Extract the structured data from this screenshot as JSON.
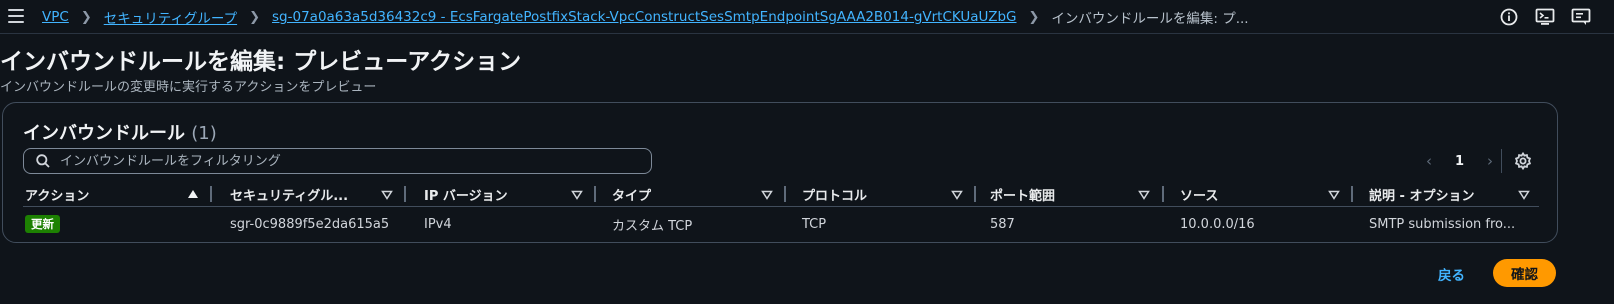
{
  "topbar": {
    "breadcrumbs": [
      "VPC",
      "セキュリティグループ",
      "sg-07a0a63a5d36432c9 - EcsFargatePostfixStack-VpcConstructSesSmtpEndpointSgAAA2B014-gVrtCKUaUZbG"
    ],
    "current": "インバウンドルールを編集: プ...",
    "icons": [
      "info-icon",
      "cloudshell-icon",
      "feedback-icon"
    ]
  },
  "page": {
    "title": "インバウンドルールを編集: プレビューアクション",
    "description": "インバウンドルールの変更時に実行するアクションをプレビュー"
  },
  "panel": {
    "title": "インバウンドルール",
    "count": "(1)",
    "filter_placeholder": "インバウンドルールをフィルタリング",
    "page_number": "1",
    "columns": [
      "アクション",
      "セキュリティグル...",
      "IP バージョン",
      "タイプ",
      "プロトコル",
      "ポート範囲",
      "ソース",
      "説明 - オプション"
    ],
    "rows": [
      {
        "action": "更新",
        "sg_rule_id": "sgr-0c9889f5e2da615a5",
        "ip_version": "IPv4",
        "type": "カスタム TCP",
        "protocol": "TCP",
        "port_range": "587",
        "source": "10.0.0.0/16",
        "description": "SMTP submission fro..."
      }
    ]
  },
  "footer": {
    "back_label": "戻る",
    "confirm_label": "確認"
  },
  "colors": {
    "background": "#0f141a",
    "link": "#42b4ff",
    "primary_button": "#ff9900",
    "badge_update": "#1d8102"
  }
}
